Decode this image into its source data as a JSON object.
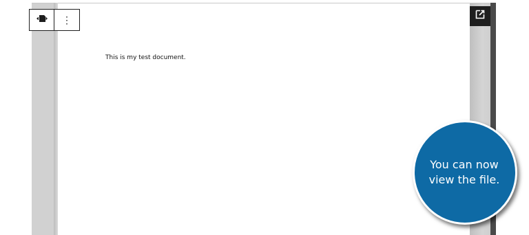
{
  "document": {
    "body_text": "This is my test document."
  },
  "toolbar": {
    "block_icon": "file-block-icon",
    "more_options_label": "⋮"
  },
  "viewer": {
    "open_icon": "open-in-new-tab-icon"
  },
  "callout": {
    "line1": "You can now",
    "line2": "view the file."
  },
  "colors": {
    "callout_fill": "#0e6aa5",
    "toolbar_border": "#1e1e1e",
    "viewer_gray": "#d1d1d1"
  }
}
